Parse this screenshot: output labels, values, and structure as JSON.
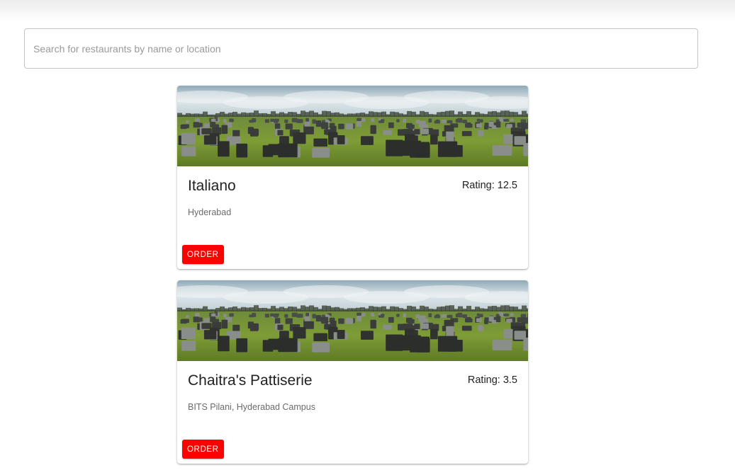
{
  "search": {
    "placeholder": "Search for restaurants by name or location",
    "value": ""
  },
  "restaurants": [
    {
      "name": "Italiano",
      "rating_label": "Rating:",
      "rating": "12.5",
      "location": "Hyderabad",
      "order_label": "ORDER"
    },
    {
      "name": "Chaitra's Pattiserie",
      "rating_label": "Rating:",
      "rating": "3.5",
      "location": "BITS Pilani, Hyderabad Campus",
      "order_label": "ORDER"
    }
  ],
  "colors": {
    "order_button": "#ff0000",
    "grass": "#6f8e2e",
    "sky": "#b7c9d2"
  },
  "icons": {
    "card_image": "field-image"
  }
}
